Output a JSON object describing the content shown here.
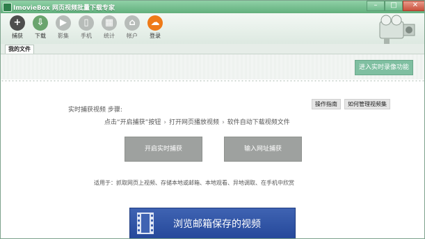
{
  "app": {
    "title": "ImovieBox 网页视频批量下载专家"
  },
  "toolbar": {
    "capture": "捕获",
    "download": "下载",
    "video": "影集",
    "phone": "手机",
    "stats": "统计",
    "account": "帐户",
    "login": "登录"
  },
  "tabs": {
    "my_files": "我的文件"
  },
  "realtime_button": "进入实时录像功能",
  "guide": {
    "ops_guide": "操作指南",
    "manage_collection": "如何管理视频集"
  },
  "steps": {
    "title": "实时捕获视频 步骤:",
    "step1": "点击“开启捕获”按钮",
    "step2": "打开网页播放视频",
    "step3": "软件自动下载视频文件"
  },
  "actions": {
    "start_capture": "开启实时捕获",
    "enter_url": "输入网址捕获"
  },
  "applies_text": "适用于：抓取网页上视频、存储本地或邮箱、本地观看、异地调取、在手机中欣赏",
  "browse_button": "浏览邮箱保存的视频",
  "colors": {
    "titlebar": "#62b07d",
    "accent_green": "#7fbfa1",
    "browse_blue": "#2b4fa3",
    "login_orange": "#ee7a18"
  }
}
